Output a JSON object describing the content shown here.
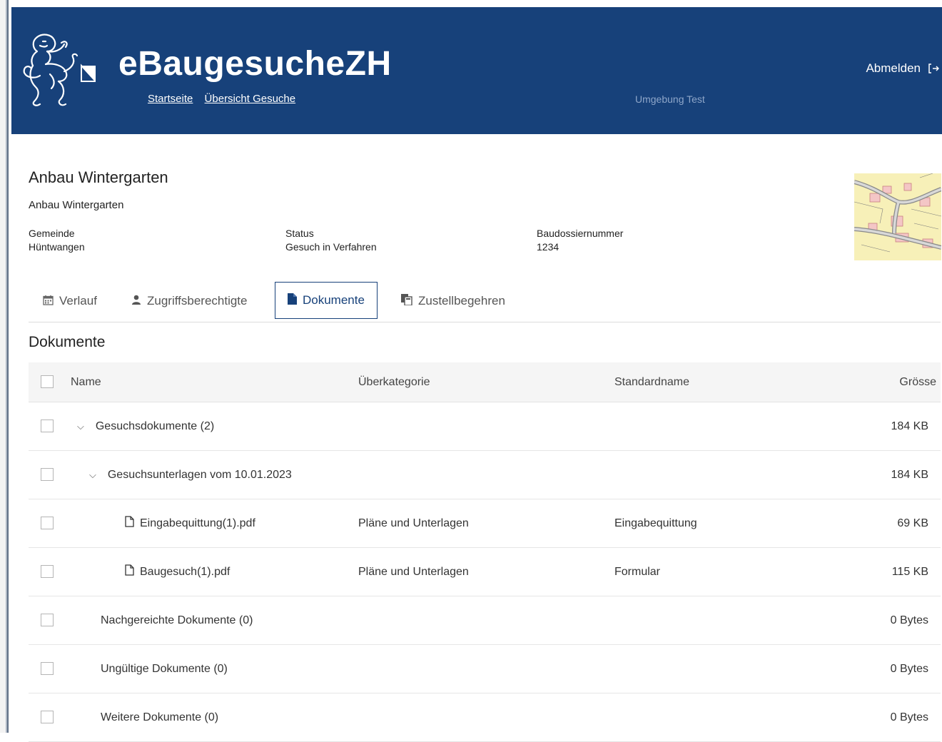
{
  "header": {
    "app_title": "eBaugesucheZH",
    "nav": [
      "Startseite",
      "Übersicht Gesuche"
    ],
    "environment": "Umgebung Test",
    "logout_label": "Abmelden"
  },
  "dossier": {
    "title": "Anbau Wintergarten",
    "subtitle": "Anbau Wintergarten",
    "gemeinde_label": "Gemeinde",
    "gemeinde_value": "Hüntwangen",
    "status_label": "Status",
    "status_value": "Gesuch in Verfahren",
    "nummer_label": "Baudossiernummer",
    "nummer_value": "1234"
  },
  "tabs": [
    {
      "label": "Verlauf",
      "icon": "calendar-icon"
    },
    {
      "label": "Zugriffsberechtigte",
      "icon": "user-icon"
    },
    {
      "label": "Dokumente",
      "icon": "document-icon",
      "active": true
    },
    {
      "label": "Zustellbegehren",
      "icon": "copy-icon"
    }
  ],
  "documents": {
    "section_title": "Dokumente",
    "columns": [
      "Name",
      "Überkategorie",
      "Standardname",
      "Grösse"
    ],
    "rows": [
      {
        "name": "Gesuchsdokumente (2)",
        "category": "",
        "standard": "",
        "size": "184 KB"
      },
      {
        "name": "Gesuchsunterlagen vom 10.01.2023",
        "category": "",
        "standard": "",
        "size": "184 KB"
      },
      {
        "name": "Eingabequittung(1).pdf",
        "category": "Pläne und Unterlagen",
        "standard": "Eingabequittung",
        "size": "69 KB"
      },
      {
        "name": "Baugesuch(1).pdf",
        "category": "Pläne und Unterlagen",
        "standard": "Formular",
        "size": "115 KB"
      },
      {
        "name": "Nachgereichte Dokumente (0)",
        "category": "",
        "standard": "",
        "size": "0 Bytes"
      },
      {
        "name": "Ungültige Dokumente (0)",
        "category": "",
        "standard": "",
        "size": "0 Bytes"
      },
      {
        "name": "Weitere Dokumente (0)",
        "category": "",
        "standard": "",
        "size": "0 Bytes"
      }
    ]
  },
  "colors": {
    "brand": "#17417a",
    "header_text": "#ffffff",
    "env_text": "#8ea6c9"
  }
}
